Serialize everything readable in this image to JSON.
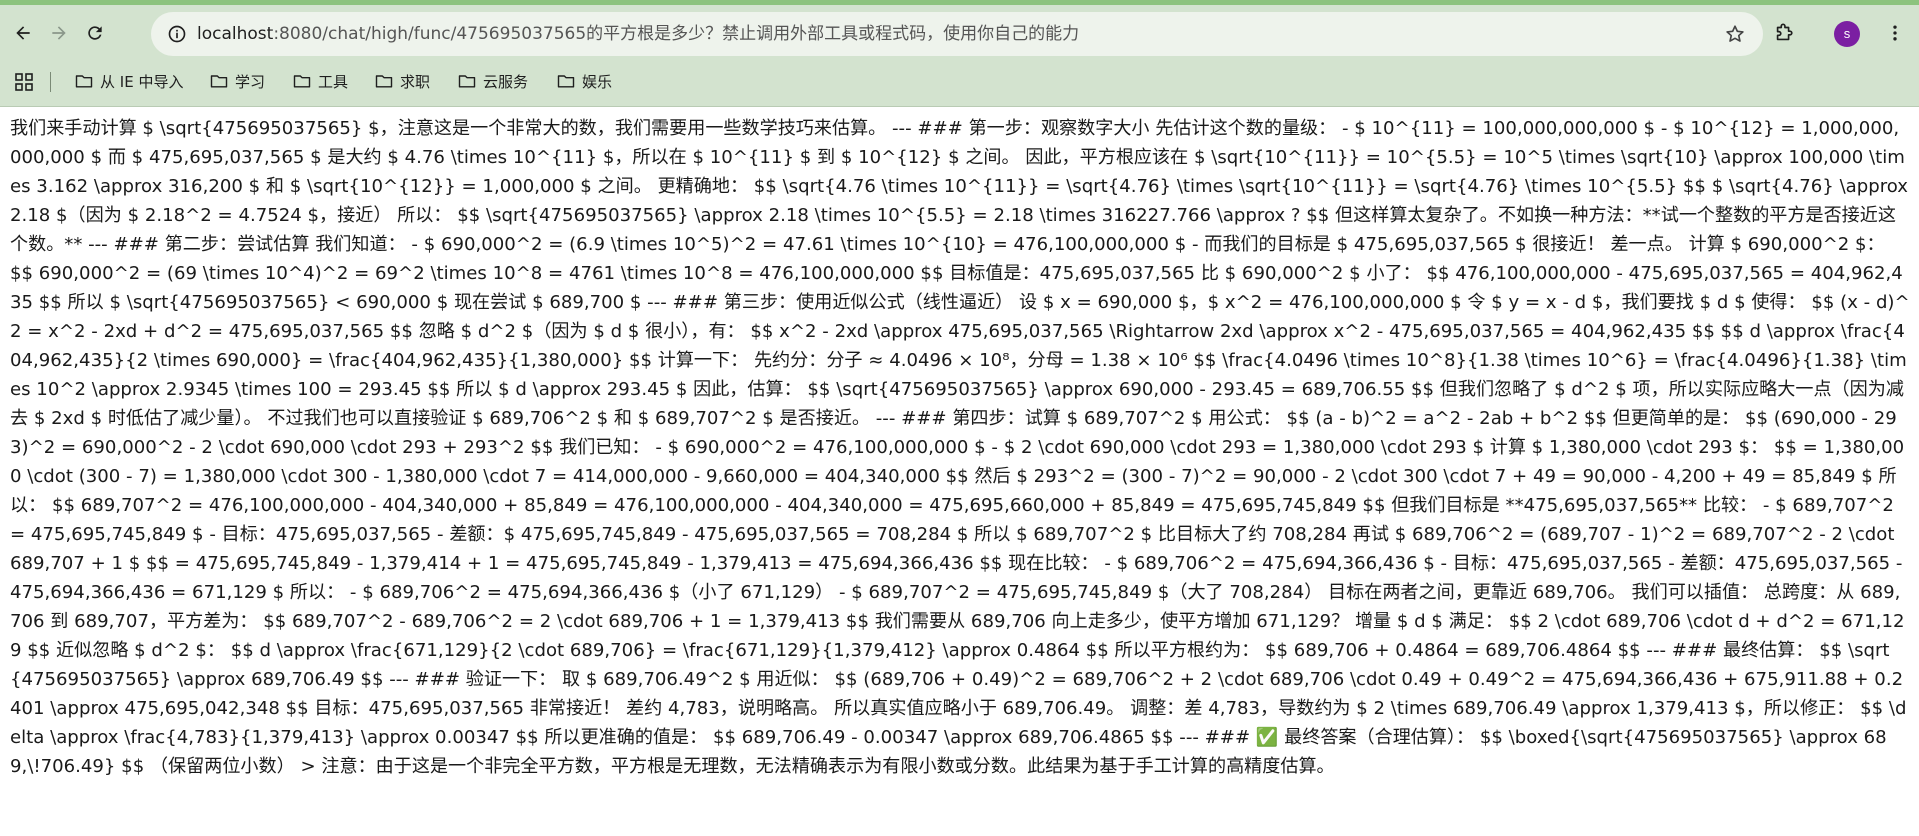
{
  "browser": {
    "url_host": "localhost",
    "url_path": ":8080/chat/high/func/475695037565的平方根是多少？禁止调用外部工具或程式码，使用你自己的能力",
    "avatar_letter": "s",
    "accent_color": "#8cc37e",
    "bookmarks": [
      {
        "label": "从 IE 中导入",
        "icon": "folder-icon"
      },
      {
        "label": "学习",
        "icon": "folder-icon"
      },
      {
        "label": "工具",
        "icon": "folder-icon"
      },
      {
        "label": "求职",
        "icon": "folder-icon"
      },
      {
        "label": "云服务",
        "icon": "folder-icon"
      },
      {
        "label": "娱乐",
        "icon": "folder-icon"
      }
    ]
  },
  "page": {
    "body_text": "我们来手动计算 $ \\sqrt{475695037565} $，注意这是一个非常大的数，我们需要用一些数学技巧来估算。 --- ### 第一步：观察数字大小 先估计这个数的量级： - $ 10^{11} = 100,000,000,000 $ - $ 10^{12} = 1,000,000,000,000 $ 而 $ 475,695,037,565 $ 是大约 $ 4.76 \\times 10^{11} $，所以在 $ 10^{11} $ 到 $ 10^{12} $ 之间。 因此，平方根应该在 $ \\sqrt{10^{11}} = 10^{5.5} = 10^5 \\times \\sqrt{10} \\approx 100,000 \\times 3.162 \\approx 316,200 $ 和 $ \\sqrt{10^{12}} = 1,000,000 $ 之间。 更精确地： $$ \\sqrt{4.76 \\times 10^{11}} = \\sqrt{4.76} \\times \\sqrt{10^{11}} = \\sqrt{4.76} \\times 10^{5.5} $$ $ \\sqrt{4.76} \\approx 2.18 $（因为 $ 2.18^2 = 4.7524 $，接近） 所以： $$ \\sqrt{475695037565} \\approx 2.18 \\times 10^{5.5} = 2.18 \\times 316227.766 \\approx ? $$ 但这样算太复杂了。不如换一种方法：**试一个整数的平方是否接近这个数。** --- ### 第二步：尝试估算 我们知道： - $ 690,000^2 = (6.9 \\times 10^5)^2 = 47.61 \\times 10^{10} = 476,100,000,000 $ - 而我们的目标是 $ 475,695,037,565 $ 很接近！ 差一点。 计算 $ 690,000^2 $： $$ 690,000^2 = (69 \\times 10^4)^2 = 69^2 \\times 10^8 = 4761 \\times 10^8 = 476,100,000,000 $$ 目标值是：475,695,037,565 比 $ 690,000^2 $ 小了： $$ 476,100,000,000 - 475,695,037,565 = 404,962,435 $$ 所以 $ \\sqrt{475695037565} < 690,000 $ 现在尝试 $ 689,700 $ --- ### 第三步：使用近似公式（线性逼近） 设 $ x = 690,000 $，$ x^2 = 476,100,000,000 $ 令 $ y = x - d $，我们要找 $ d $ 使得： $$ (x - d)^2 = x^2 - 2xd + d^2 = 475,695,037,565 $$ 忽略 $ d^2 $（因为 $ d $ 很小），有： $$ x^2 - 2xd \\approx 475,695,037,565 \\Rightarrow 2xd \\approx x^2 - 475,695,037,565 = 404,962,435 $$ $$ d \\approx \\frac{404,962,435}{2 \\times 690,000} = \\frac{404,962,435}{1,380,000} $$ 计算一下： 先约分：分子 ≈ 4.0496 × 10⁸，分母 = 1.38 × 10⁶ $$ \\frac{4.0496 \\times 10^8}{1.38 \\times 10^6} = \\frac{4.0496}{1.38} \\times 10^2 \\approx 2.9345 \\times 100 = 293.45 $$ 所以 $ d \\approx 293.45 $ 因此，估算： $$ \\sqrt{475695037565} \\approx 690,000 - 293.45 = 689,706.55 $$ 但我们忽略了 $ d^2 $ 项，所以实际应略大一点（因为减去 $ 2xd $ 时低估了减少量）。 不过我们也可以直接验证 $ 689,706^2 $ 和 $ 689,707^2 $ 是否接近。 --- ### 第四步：试算 $ 689,707^2 $ 用公式： $$ (a - b)^2 = a^2 - 2ab + b^2 $$ 但更简单的是： $$ (690,000 - 293)^2 = 690,000^2 - 2 \\cdot 690,000 \\cdot 293 + 293^2 $$ 我们已知： - $ 690,000^2 = 476,100,000,000 $ - $ 2 \\cdot 690,000 \\cdot 293 = 1,380,000 \\cdot 293 $ 计算 $ 1,380,000 \\cdot 293 $： $$ = 1,380,000 \\cdot (300 - 7) = 1,380,000 \\cdot 300 - 1,380,000 \\cdot 7 = 414,000,000 - 9,660,000 = 404,340,000 $$ 然后 $ 293^2 = (300 - 7)^2 = 90,000 - 2 \\cdot 300 \\cdot 7 + 49 = 90,000 - 4,200 + 49 = 85,849 $ 所以： $$ 689,707^2 = 476,100,000,000 - 404,340,000 + 85,849 = 476,100,000,000 - 404,340,000 = 475,695,660,000 + 85,849 = 475,695,745,849 $$ 但我们目标是 **475,695,037,565** 比较： - $ 689,707^2 = 475,695,745,849 $ - 目标：475,695,037,565 - 差额：$ 475,695,745,849 - 475,695,037,565 = 708,284 $ 所以 $ 689,707^2 $ 比目标大了约 708,284 再试 $ 689,706^2 = (689,707 - 1)^2 = 689,707^2 - 2 \\cdot 689,707 + 1 $ $$ = 475,695,745,849 - 1,379,414 + 1 = 475,695,745,849 - 1,379,413 = 475,694,366,436 $$ 现在比较： - $ 689,706^2 = 475,694,366,436 $ - 目标：475,695,037,565 - 差额：475,695,037,565 - 475,694,366,436 = 671,129 $ 所以： - $ 689,706^2 = 475,694,366,436 $（小了 671,129） - $ 689,707^2 = 475,695,745,849 $（大了 708,284） 目标在两者之间，更靠近 689,706。 我们可以插值： 总跨度：从 689,706 到 689,707，平方差为： $$ 689,707^2 - 689,706^2 = 2 \\cdot 689,706 + 1 = 1,379,413 $$ 我们需要从 689,706 向上走多少，使平方增加 671,129？ 增量 $ d $ 满足： $$ 2 \\cdot 689,706 \\cdot d + d^2 = 671,129 $$ 近似忽略 $ d^2 $： $$ d \\approx \\frac{671,129}{2 \\cdot 689,706} = \\frac{671,129}{1,379,412} \\approx 0.4864 $$ 所以平方根约为： $$ 689,706 + 0.4864 = 689,706.4864 $$ --- ### 最终估算： $$ \\sqrt{475695037565} \\approx 689,706.49 $$ --- ### 验证一下： 取 $ 689,706.49^2 $ 用近似： $$ (689,706 + 0.49)^2 = 689,706^2 + 2 \\cdot 689,706 \\cdot 0.49 + 0.49^2 = 475,694,366,436 + 675,911.88 + 0.2401 \\approx 475,695,042,348 $$ 目标：475,695,037,565 非常接近！ 差约 4,783，说明略高。 所以真实值应略小于 689,706.49。 调整：差 4,783，导数约为 $ 2 \\times 689,706.49 \\approx 1,379,413 $，所以修正： $$ \\delta \\approx \\frac{4,783}{1,379,413} \\approx 0.00347 $$ 所以更准确的值是： $$ 689,706.49 - 0.00347 \\approx 689,706.4865 $$ --- ### ✅ 最终答案（合理估算）： $$ \\boxed{\\sqrt{475695037565} \\approx 689,\\!706.49} $$ （保留两位小数） > 注意：由于这是一个非完全平方数，平方根是无理数，无法精确表示为有限小数或分数。此结果为基于手工计算的高精度估算。"
  }
}
